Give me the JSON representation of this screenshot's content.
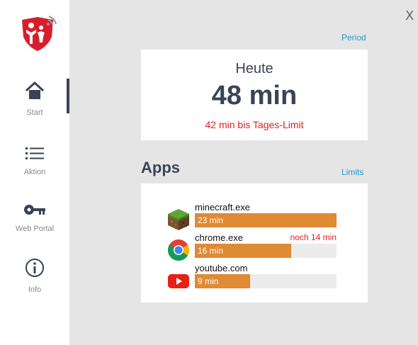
{
  "window": {
    "close_label": "X"
  },
  "sidebar": {
    "items": [
      {
        "label": "Start",
        "icon": "home-icon",
        "active": true
      },
      {
        "label": "Aktion",
        "icon": "list-icon",
        "active": false
      },
      {
        "label": "Web Portal",
        "icon": "key-icon",
        "active": false
      },
      {
        "label": "Info",
        "icon": "info-icon",
        "active": false
      }
    ]
  },
  "colors": {
    "accent": "#df8a35",
    "link": "#1e9ad6",
    "alert": "#e02020",
    "brand": "#d61f2c",
    "text": "#3a4456"
  },
  "period_link": "Period",
  "today": {
    "title": "Heute",
    "value": "48 min",
    "limit_text": "42 min bis Tages-Limit"
  },
  "apps": {
    "title": "Apps",
    "limits_link": "Limits",
    "items": [
      {
        "name": "minecraft.exe",
        "usage": "23 min",
        "fraction": 1.0,
        "remaining": "",
        "icon": "minecraft-icon"
      },
      {
        "name": "chrome.exe",
        "usage": "16 min",
        "fraction": 0.68,
        "remaining": "noch  14 min",
        "icon": "chrome-icon"
      },
      {
        "name": "youtube.com",
        "usage": "9 min",
        "fraction": 0.39,
        "remaining": "",
        "icon": "youtube-icon"
      }
    ]
  }
}
